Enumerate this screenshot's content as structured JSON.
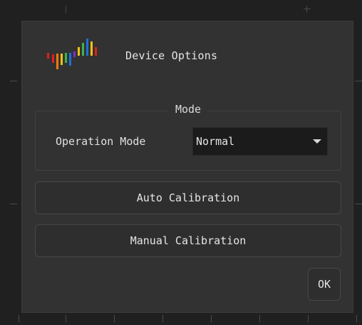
{
  "dialog": {
    "title": "Device Options"
  },
  "logo": {
    "icon": "spectrum-bars-icon",
    "colors": [
      "#e02020",
      "#f07a10",
      "#f2c414",
      "#3cb44a",
      "#1e6fe0",
      "#7b2fd0",
      "#e02020"
    ]
  },
  "mode_group": {
    "title": "Mode",
    "operation_label": "Operation Mode",
    "operation_select": {
      "value": "Normal",
      "icon": "chevron-down-icon"
    }
  },
  "buttons": {
    "auto_calibration": "Auto Calibration",
    "manual_calibration": "Manual Calibration",
    "ok": "OK"
  },
  "colors": {
    "background": "#202020",
    "dialog_bg": "#323232",
    "button_bg": "#2e2e2e",
    "select_bg": "#1b1b1b",
    "text": "#e6e6e6"
  }
}
